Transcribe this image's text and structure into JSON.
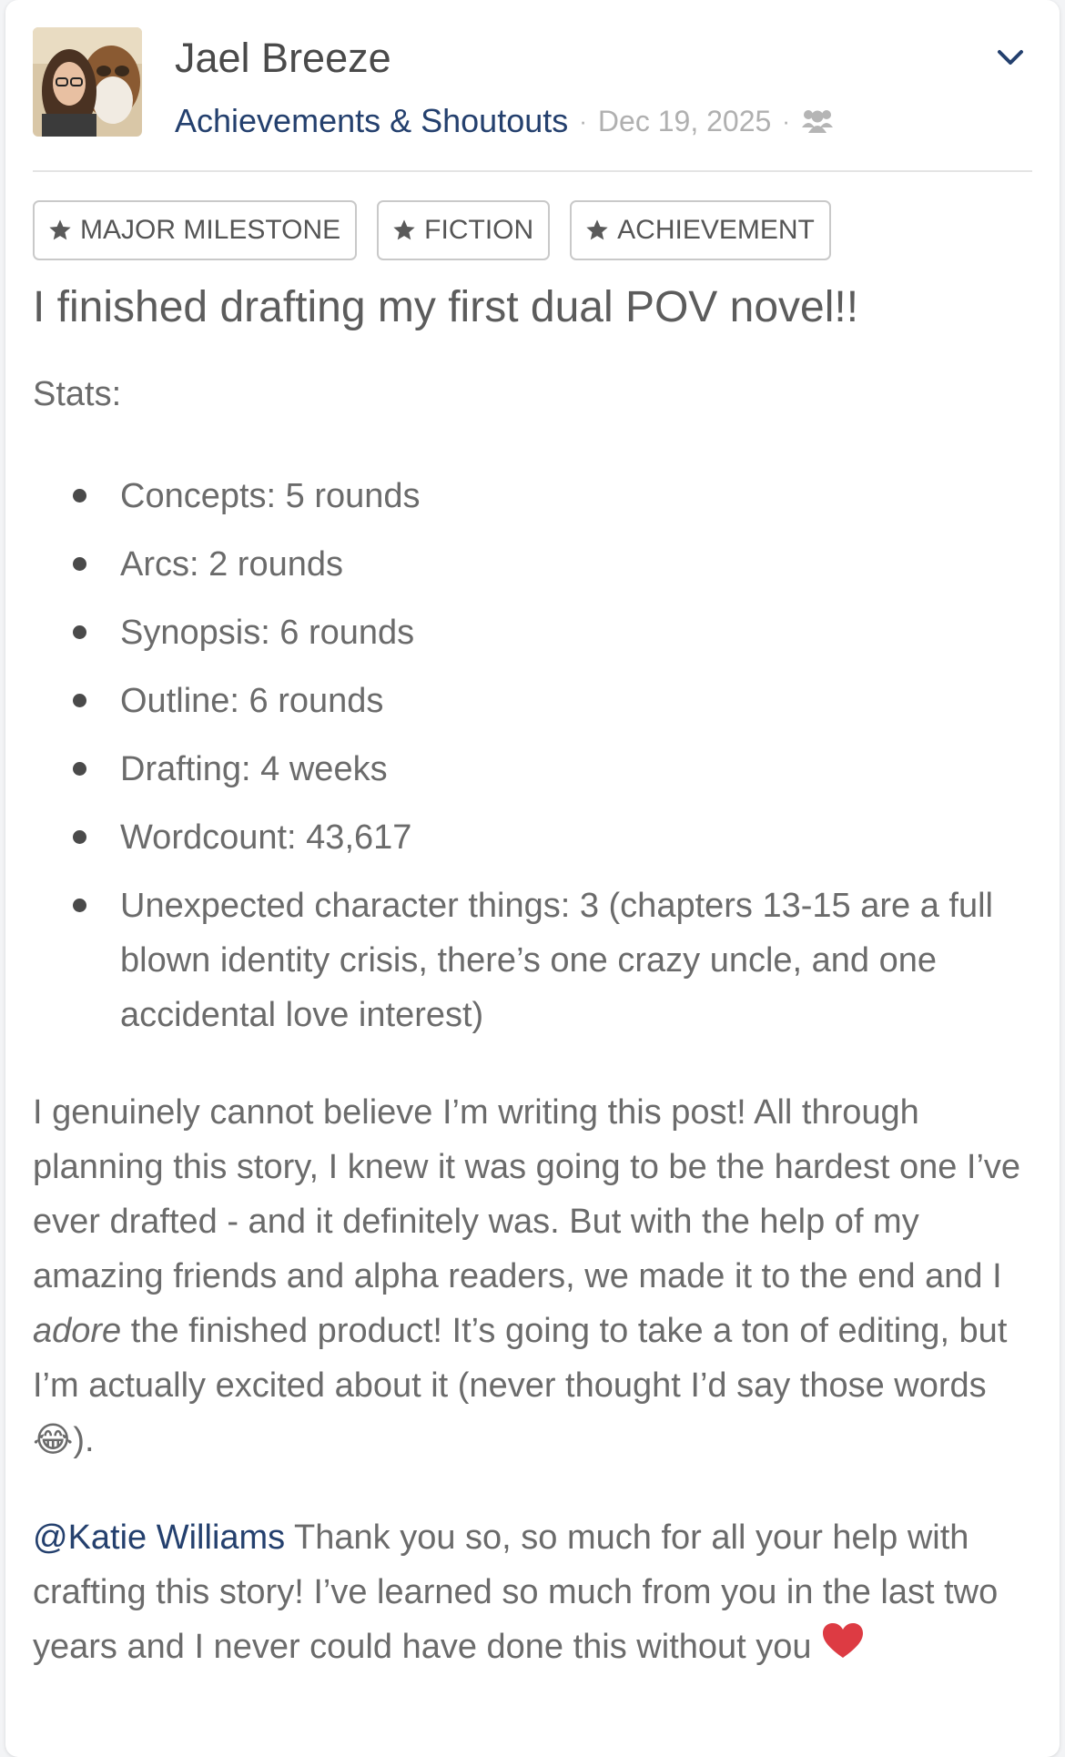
{
  "post": {
    "author_name": "Jael Breeze",
    "group_name": "Achievements & Shoutouts",
    "separator": "·",
    "date": "Dec 19, 2025",
    "visibility_icon": "group-people-icon",
    "menu_icon": "chevron-down-icon",
    "tags": [
      {
        "label": "MAJOR MILESTONE",
        "icon": "star-icon"
      },
      {
        "label": "FICTION",
        "icon": "star-icon"
      },
      {
        "label": "ACHIEVEMENT",
        "icon": "star-icon"
      }
    ],
    "title": "I finished drafting my first dual POV novel!!",
    "stats_label": "Stats:",
    "stats": [
      "Concepts: 5 rounds",
      "Arcs: 2 rounds",
      "Synopsis: 6 rounds",
      "Outline: 6 rounds",
      "Drafting: 4 weeks",
      "Wordcount: 43,617",
      "Unexpected character things: 3 (chapters 13-15 are a full blown identity crisis, there’s one crazy uncle, and one accidental love interest)"
    ],
    "paragraph": {
      "part1": "I genuinely cannot believe I’m writing this post! All through planning this story, I knew it was going to be the hardest one I’ve ever drafted - and it definitely was. But with the help of my amazing friends and alpha readers, we made it to the end and I ",
      "emphasis": "adore",
      "part2": " the finished product! It’s going to take a ton of editing, but I’m actually excited about it (never thought I’d say those words ",
      "emoji": "😂",
      "part3": ")."
    },
    "shoutout": {
      "mention": "@Katie Williams",
      "text": " Thank you so, so much for all your help with crafting this story! I’ve learned so much from you in the last two years and I never could have done this without you ",
      "emoji_icon": "red-heart-icon"
    }
  },
  "colors": {
    "link": "#24406e",
    "text": "#6b6b6b",
    "muted": "#b0b0b0",
    "heart": "#dd3b43"
  }
}
